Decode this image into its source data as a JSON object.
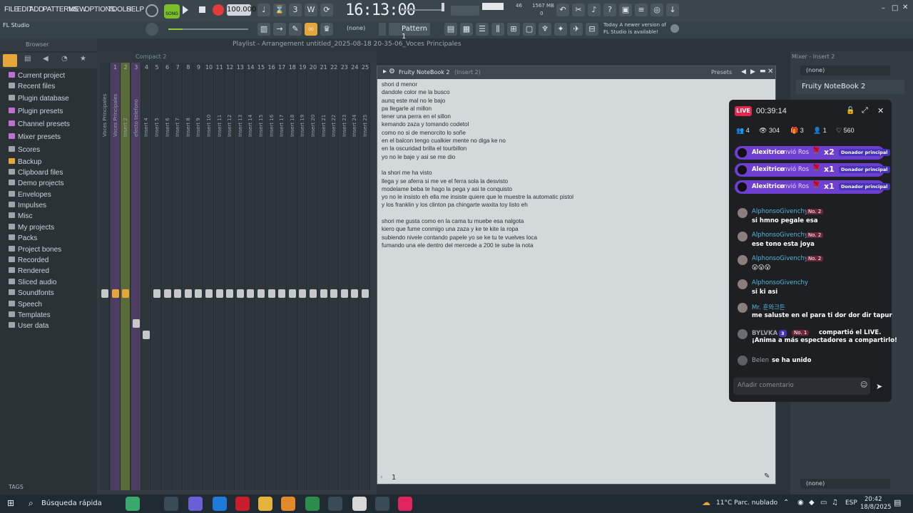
{
  "menubar": {
    "items": [
      "FILE",
      "EDIT",
      "ADD",
      "PATTERNS",
      "VIEW",
      "OPTIONS",
      "TOOLS",
      "HELP"
    ],
    "song_label": "SONG",
    "tempo": "100.000",
    "time": "16:13:00",
    "cpu_value": "46",
    "mem_value": "1567 MB",
    "mem_sub": "0"
  },
  "toolbar2": {
    "app_label": "FL Studio",
    "none_label": "(none)",
    "pattern_label": "Pattern 1",
    "news_line1": "Today  A newer version of",
    "news_line2": "FL Studio is available!"
  },
  "browser": {
    "header": "Browser",
    "items": [
      "Current project",
      "Recent files",
      "Plugin database",
      "Plugin presets",
      "Channel presets",
      "Mixer presets",
      "Scores",
      "Backup",
      "Clipboard files",
      "Demo projects",
      "Envelopes",
      "Impulses",
      "Misc",
      "My projects",
      "Packs",
      "Project bones",
      "Recorded",
      "Rendered",
      "Sliced audio",
      "Soundfonts",
      "Speech",
      "Templates",
      "User data"
    ],
    "tags_label": "TAGS"
  },
  "mixer": {
    "compact_label": "Compact 2",
    "playlist_path": "Playlist - Arrangement    untitled_2025-08-18 20-35-06_Voces Principales",
    "strip_names": [
      "Voces Principales",
      "Voces Principales",
      "Insert 2",
      "efecto telefono",
      "Insert 4",
      "Insert 5",
      "Insert 6",
      "Insert 7",
      "Insert 8",
      "Insert 9",
      "Insert 10",
      "Insert 11",
      "Insert 12",
      "Insert 13",
      "Insert 14",
      "Insert 15",
      "Insert 16",
      "Insert 17",
      "Insert 18",
      "Insert 19",
      "Insert 20",
      "Insert 21",
      "Insert 22",
      "Insert 23",
      "Insert 24",
      "Insert 25"
    ],
    "strip_numbers": [
      "1",
      "2",
      "3",
      "4",
      "5",
      "6",
      "7",
      "8",
      "9",
      "10",
      "11",
      "12",
      "13",
      "14",
      "15",
      "16",
      "17",
      "18",
      "19",
      "20",
      "21",
      "22",
      "23",
      "24",
      "25"
    ]
  },
  "notebook": {
    "title": "Fruity NoteBook 2",
    "insert": "(Insert 2)",
    "presets_label": "Presets",
    "page_number": "1",
    "text": "shori d menor\ndandole color me la busco\naunq este mal no le bajo\npa llegarle al millon\ntener una perra en el sillon\nkemando zaza y tomando codetol\ncomo no si de menorcito lo soñe\nen el balcon tengo cualkier mente no diga ke no\nen la oscuridad brilla el tourbillon\nyo no le baje y asi se me dio\n\nla shori me ha visto\nllega y se aferra si me ve el ferra sola la desvisto\nmodelame beba te hago la pega y asi te conquisto\nyo no le insisto eh ella me insiste quiere que le muestre la automatic pistol\ny los franklin y los clinton pa chingarte waxita toy listo eh\n\nshori me gusta como en la cama tu muebe esa nalgota\nkiero que fume conmigo una zaza y ke te kite la ropa\nsubiendo nivele contando papele yo se ke tu te vuelves loca\nfumando una ele dentro del mercede a 200 te sube la nota"
  },
  "rpanel": {
    "header": "Mixer - Insert 2",
    "none_top": "(none)",
    "slot_label": "Fruity NoteBook 2",
    "none_bottom": "(none)"
  },
  "live": {
    "live_badge": "LIVE",
    "duration": "00:39:14",
    "stats": [
      "4",
      "304",
      "3",
      "1",
      "560"
    ],
    "gifts": [
      {
        "user": "Alexitrico",
        "action": "envió Ros",
        "count": "x2",
        "badge": "Donador principal"
      },
      {
        "user": "Alexitrico",
        "action": "envió Ros",
        "count": "x1",
        "badge": "Donador principal"
      },
      {
        "user": "Alexitrico",
        "action": "envió Ros",
        "count": "x1",
        "badge": "Donador principal"
      }
    ],
    "comments": [
      {
        "user": "AlphonsoGivenchy",
        "rank": "No. 2",
        "msg": "si hmno pegale esa"
      },
      {
        "user": "AlphonsoGivenchy",
        "rank": "No. 2",
        "msg": "ese tono esta joya"
      },
      {
        "user": "AlphonsoGivenchy",
        "rank": "No. 2",
        "msg": "😮😮😮"
      },
      {
        "user": "AlphonsoGivenchy",
        "rank": "",
        "msg": "si ki asi"
      },
      {
        "user": "Mr. 훈와크튼",
        "rank": "",
        "msg": "me saluste en el para ti dor dor dir tapur"
      }
    ],
    "share_user": "BYLVKA",
    "share_level": "3",
    "share_rank": "No. 1",
    "share_msg1": "compartió el LIVE.",
    "share_msg2": "¡Anima a más espectadores a compartirlo!",
    "join_user": "Belen",
    "join_msg": "se ha unido",
    "comment_placeholder": "Añadir comentario"
  },
  "taskbar": {
    "search_label": "Búsqueda rápida",
    "weather": "11°C  Parc. nublado",
    "lang": "ESP",
    "clock_time": "20:42",
    "clock_date": "18/8/2025"
  },
  "colors": {
    "accent_green": "#7bbf2a",
    "live_pink": "#e5264f",
    "gift_purple": "#6e3fd1",
    "username_blue": "#55b7dd"
  }
}
